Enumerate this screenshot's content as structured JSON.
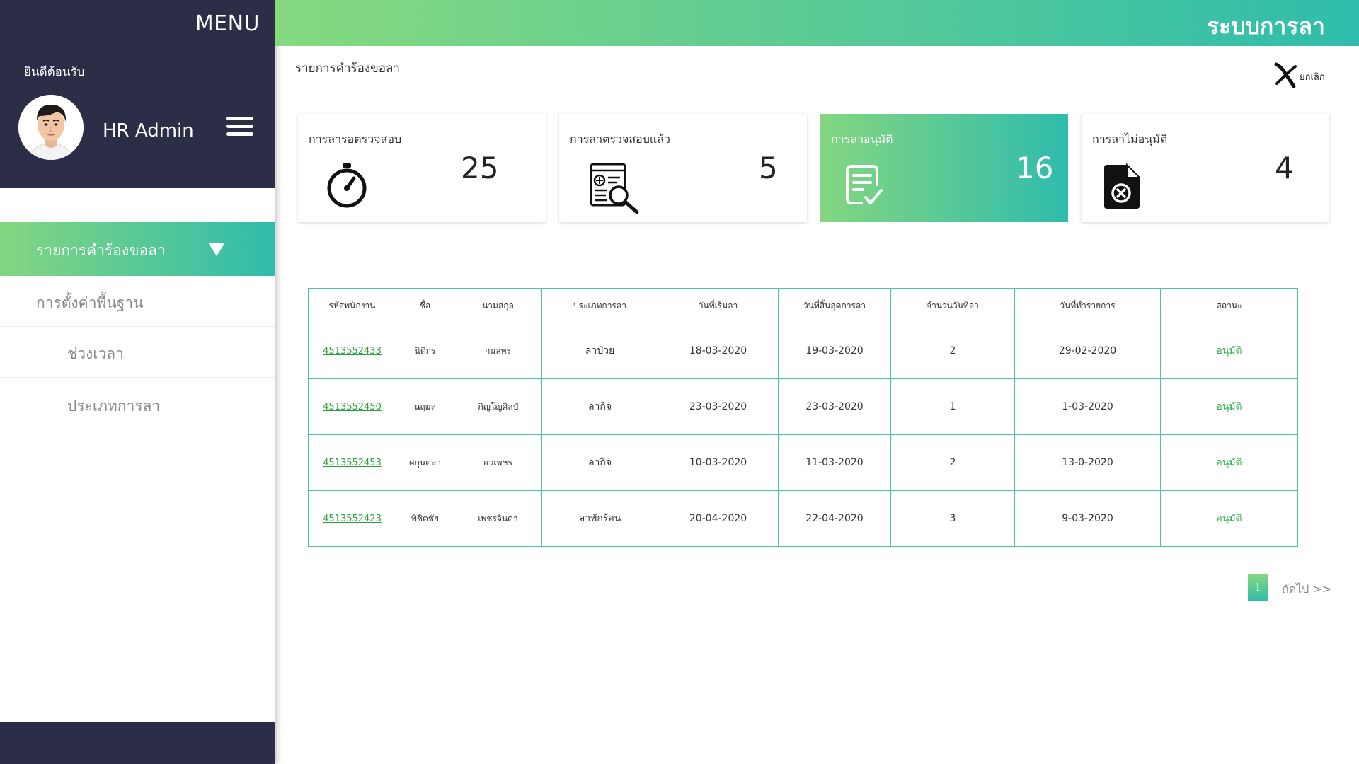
{
  "sidebar": {
    "menu_title": "MENU",
    "welcome": "ยินดีต้อนรับ",
    "user_name": "HR Admin",
    "active_item": "รายการคำร้องขอลา",
    "items": [
      {
        "label": "การตั้งค่าพื้นฐาน"
      },
      {
        "label": "ช่วงเวลา"
      },
      {
        "label": "ประเภทการลา"
      }
    ]
  },
  "header": {
    "app_title": "ระบบการลา"
  },
  "main": {
    "page_title": "รายการคำร้องขอลา",
    "cancel_label": "ยกเลิก"
  },
  "cards": [
    {
      "label": "การลารอตรวจสอบ",
      "value": "25",
      "icon": "timer-icon"
    },
    {
      "label": "การลาตรวจสอบแล้ว",
      "value": "5",
      "icon": "document-search-icon"
    },
    {
      "label": "การลาอนุมัติ",
      "value": "16",
      "icon": "document-check-icon"
    },
    {
      "label": "การลาไม่อนุมัติ",
      "value": "4",
      "icon": "document-reject-icon"
    }
  ],
  "table": {
    "headers": [
      "รหัสพนักงาน",
      "ชื่อ",
      "นามสกุล",
      "ประเภทการลา",
      "วันที่เริ่มลา",
      "วันที่สิ้นสุดการลา",
      "จำนวนวันที่ลา",
      "วันที่ทำรายการ",
      "สถานะ"
    ],
    "rows": [
      [
        "4513552433",
        "นิติกร",
        "กมลพร",
        "ลาป่วย",
        "18-03-2020",
        "19-03-2020",
        "2",
        "29-02-2020",
        "อนุมัติ"
      ],
      [
        "4513552450",
        "นฤมล",
        "ภิญโญศิลป์",
        "ลากิจ",
        "23-03-2020",
        "23-03-2020",
        "1",
        "1-03-2020",
        "อนุมัติ"
      ],
      [
        "4513552453",
        "ศกุนตลา",
        "แวเพชร",
        "ลากิจ",
        "10-03-2020",
        "11-03-2020",
        "2",
        "13-0-2020",
        "อนุมัติ"
      ],
      [
        "4513552423",
        "พิชิตชัย",
        "เพชรจินดา",
        "ลาพักร้อน",
        "20-04-2020",
        "22-04-2020",
        "3",
        "9-03-2020",
        "อนุมัติ"
      ]
    ]
  },
  "pagination": {
    "current": "1",
    "next_label": "ถัดไป >>"
  },
  "colors": {
    "sidebar_dark": "#2c2e48",
    "gradient_start": "#84d680",
    "gradient_end": "#2fbcac",
    "status_green": "#2bb34b"
  }
}
